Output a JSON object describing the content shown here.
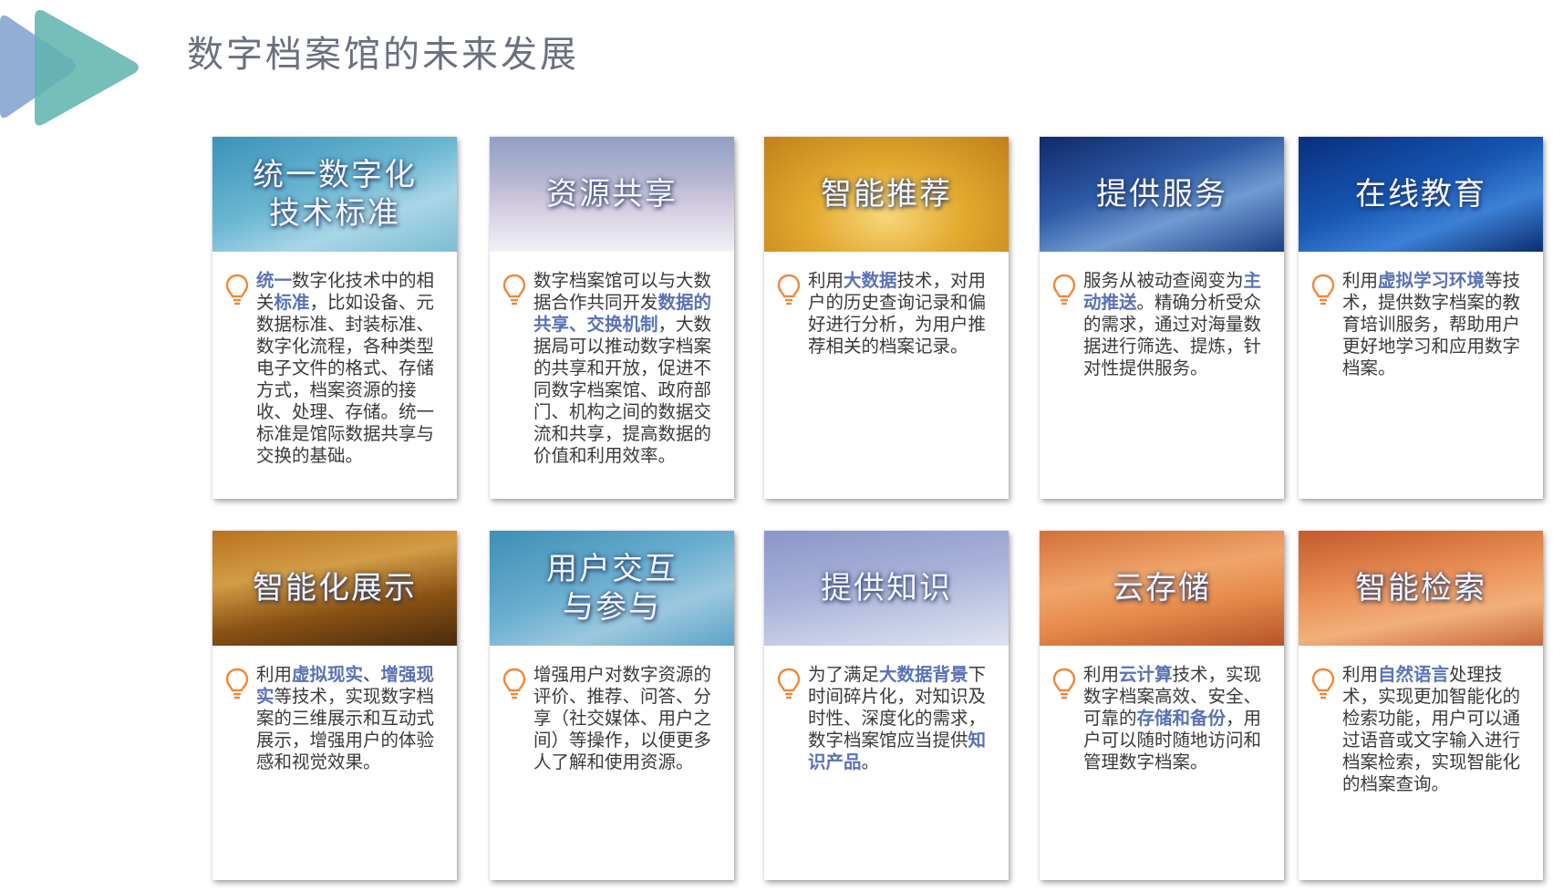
{
  "title": "数字档案馆的未来发展",
  "cards": [
    {
      "title": "统一数字化\n技术标准",
      "body": [
        {
          "t": "统一",
          "h": true
        },
        {
          "t": "数字化技术中的相关",
          "h": false
        },
        {
          "t": "标准",
          "h": true
        },
        {
          "t": "，比如设备、元数据标准、封装标准、数字化流程，各种类型电子文件的格式、存储方式，档案资源的接收、处理、存储。统一标准是馆际数据共享与交换的基础。",
          "h": false
        }
      ]
    },
    {
      "title": "资源共享",
      "body": [
        {
          "t": "数字档案馆可以与大数据合作共同开发",
          "h": false
        },
        {
          "t": "数据的共享、交换机制",
          "h": true
        },
        {
          "t": "，大数据局可以推动数字档案的共享和开放，促进不同数字档案馆、政府部门、机构之间的数据交流和共享，提高数据的价值和利用效率。",
          "h": false
        }
      ]
    },
    {
      "title": "智能推荐",
      "body": [
        {
          "t": "利用",
          "h": false
        },
        {
          "t": "大数据",
          "h": true
        },
        {
          "t": "技术，对用户的历史查询记录和偏好进行分析，为用户推荐相关的档案记录。",
          "h": false
        }
      ]
    },
    {
      "title": "提供服务",
      "body": [
        {
          "t": "服务从被动查阅变为",
          "h": false
        },
        {
          "t": "主动推送",
          "h": true
        },
        {
          "t": "。精确分析受众的需求，通过对海量数据进行筛选、提炼，针对性提供服务。",
          "h": false
        }
      ]
    },
    {
      "title": "在线教育",
      "body": [
        {
          "t": "利用",
          "h": false
        },
        {
          "t": "虚拟学习环境",
          "h": true
        },
        {
          "t": "等技术，提供数字档案的教育培训服务，帮助用户更好地学习和应用数字档案。",
          "h": false
        }
      ]
    },
    {
      "title": "智能化展示",
      "body": [
        {
          "t": "利用",
          "h": false
        },
        {
          "t": "虚拟现实",
          "h": true
        },
        {
          "t": "、",
          "h": false
        },
        {
          "t": "增强现实",
          "h": true
        },
        {
          "t": "等技术，实现数字档案的三维展示和互动式展示，增强用户的体验感和视觉效果。",
          "h": false
        }
      ]
    },
    {
      "title": "用户交互\n与参与",
      "body": [
        {
          "t": "增强用户对数字资源的评价、推荐、问答、分享（社交媒体、用户之间）等操作，以便更多人了解和使用资源。",
          "h": false
        }
      ]
    },
    {
      "title": "提供知识",
      "body": [
        {
          "t": "为了满足",
          "h": false
        },
        {
          "t": "大数据背景",
          "h": true
        },
        {
          "t": "下时间碎片化，对知识及时性、深度化的需求，数字档案馆应当提供",
          "h": false
        },
        {
          "t": "知识产品",
          "h": true
        },
        {
          "t": "。",
          "h": false
        }
      ]
    },
    {
      "title": "云存储",
      "body": [
        {
          "t": "利用",
          "h": false
        },
        {
          "t": "云计算",
          "h": true
        },
        {
          "t": "技术，实现数字档案高效、安全、可靠的",
          "h": false
        },
        {
          "t": "存储和备份",
          "h": true
        },
        {
          "t": "，用户可以随时随地访问和管理数字档案。",
          "h": false
        }
      ]
    },
    {
      "title": "智能检索",
      "body": [
        {
          "t": "利用",
          "h": false
        },
        {
          "t": "自然语言",
          "h": true
        },
        {
          "t": "处理技术，实现更加智能化的检索功能，用户可以通过语音或文字输入进行档案检索，实现智能化的档案查询。",
          "h": false
        }
      ]
    }
  ]
}
